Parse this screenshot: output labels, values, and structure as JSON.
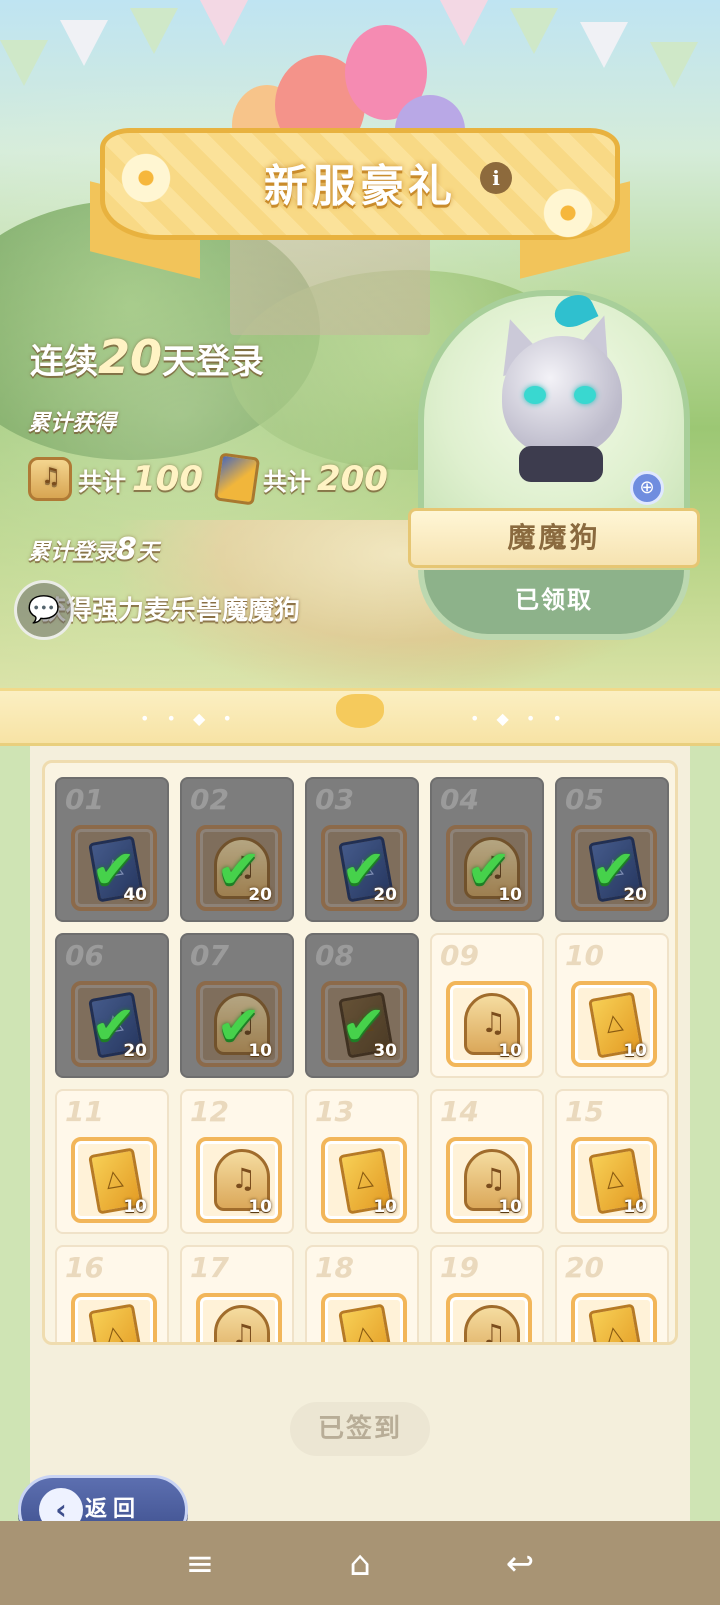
{
  "banner": {
    "title": "新服豪礼",
    "info_glyph": "i"
  },
  "login": {
    "prefix": "连续",
    "days_total": "20",
    "suffix": "天登录",
    "accumulated_label": "累计获得",
    "harp_total_label": "共计",
    "harp_total": "100",
    "card_total_label": "共计",
    "card_total": "200",
    "days_logged_prefix": "累计登录",
    "days_logged": "8",
    "days_logged_suffix": "天",
    "reward_text": "获得强力麦乐兽魔魔狗"
  },
  "pet": {
    "name": "魔魔狗",
    "status": "已领取",
    "zoom_icon": "zoom-in-icon"
  },
  "calendar": {
    "days": [
      {
        "day": "01",
        "item": "blue-card",
        "qty": "40",
        "claimed": true
      },
      {
        "day": "02",
        "item": "harp",
        "qty": "20",
        "claimed": true
      },
      {
        "day": "03",
        "item": "blue-card",
        "qty": "20",
        "claimed": true
      },
      {
        "day": "04",
        "item": "harp",
        "qty": "10",
        "claimed": true
      },
      {
        "day": "05",
        "item": "blue-card",
        "qty": "20",
        "claimed": true
      },
      {
        "day": "06",
        "item": "blue-card",
        "qty": "20",
        "claimed": true
      },
      {
        "day": "07",
        "item": "harp",
        "qty": "10",
        "claimed": true
      },
      {
        "day": "08",
        "item": "brown-card",
        "qty": "30",
        "claimed": true
      },
      {
        "day": "09",
        "item": "harp",
        "qty": "10",
        "claimed": false
      },
      {
        "day": "10",
        "item": "gold-card",
        "qty": "10",
        "claimed": false
      },
      {
        "day": "11",
        "item": "gold-card",
        "qty": "10",
        "claimed": false
      },
      {
        "day": "12",
        "item": "harp",
        "qty": "10",
        "claimed": false
      },
      {
        "day": "13",
        "item": "gold-card",
        "qty": "10",
        "claimed": false
      },
      {
        "day": "14",
        "item": "harp",
        "qty": "10",
        "claimed": false
      },
      {
        "day": "15",
        "item": "gold-card",
        "qty": "10",
        "claimed": false
      },
      {
        "day": "16",
        "item": "gold-card",
        "qty": "",
        "claimed": false
      },
      {
        "day": "17",
        "item": "harp",
        "qty": "",
        "claimed": false
      },
      {
        "day": "18",
        "item": "gold-card",
        "qty": "",
        "claimed": false
      },
      {
        "day": "19",
        "item": "harp",
        "qty": "",
        "claimed": false
      },
      {
        "day": "20",
        "item": "gold-card",
        "qty": "",
        "claimed": false
      }
    ],
    "check_glyph": "✔"
  },
  "signed_button": "已签到",
  "back_button": {
    "label": "返回",
    "glyph": "‹"
  },
  "chat_glyph": "💬",
  "navbar": {
    "menu": "≡",
    "home": "⌂",
    "back": "↩"
  }
}
